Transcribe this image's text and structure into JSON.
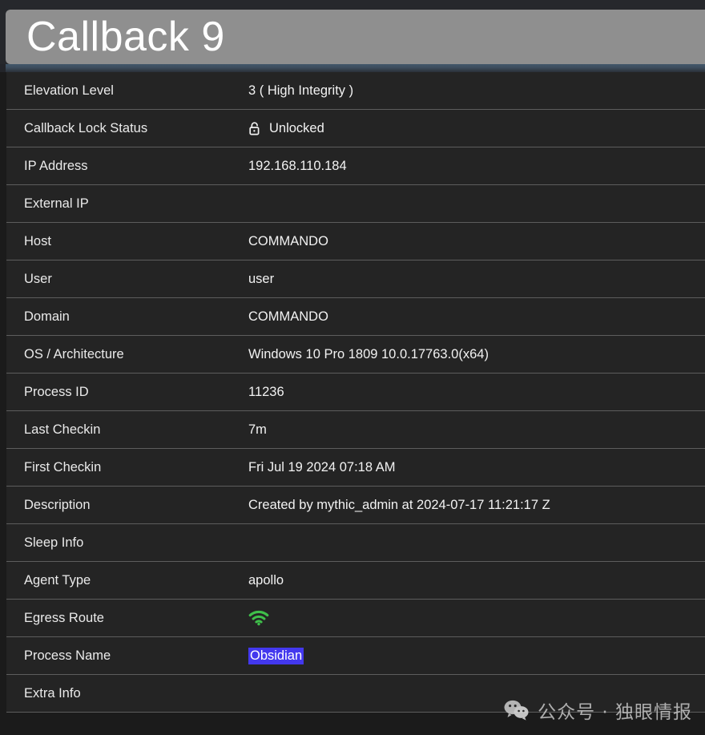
{
  "header": {
    "title": "Callback 9"
  },
  "rows": [
    {
      "label": "Elevation Level",
      "value": "3 ( High Integrity )",
      "icon": null
    },
    {
      "label": "Callback Lock Status",
      "value": "Unlocked",
      "icon": "unlock-icon"
    },
    {
      "label": "IP Address",
      "value": "192.168.110.184",
      "icon": null
    },
    {
      "label": "External IP",
      "value": "",
      "icon": null
    },
    {
      "label": "Host",
      "value": "COMMANDO",
      "icon": null
    },
    {
      "label": "User",
      "value": "user",
      "icon": null
    },
    {
      "label": "Domain",
      "value": "COMMANDO",
      "icon": null
    },
    {
      "label": "OS / Architecture",
      "value": "Windows 10 Pro 1809 10.0.17763.0(x64)",
      "icon": null
    },
    {
      "label": "Process ID",
      "value": "11236",
      "icon": null
    },
    {
      "label": "Last Checkin",
      "value": "7m",
      "icon": null
    },
    {
      "label": "First Checkin",
      "value": "Fri Jul 19 2024 07:18 AM",
      "icon": null
    },
    {
      "label": "Description",
      "value": "Created by mythic_admin at 2024-07-17 11:21:17 Z",
      "icon": null
    },
    {
      "label": "Sleep Info",
      "value": "",
      "icon": null
    },
    {
      "label": "Agent Type",
      "value": "apollo",
      "icon": null
    },
    {
      "label": "Egress Route",
      "value": "",
      "icon": "wifi-icon"
    },
    {
      "label": "Process Name",
      "value": "Obsidian",
      "icon": null,
      "selected": true
    },
    {
      "label": "Extra Info",
      "value": "",
      "icon": null
    }
  ],
  "watermark": {
    "icon": "wechat-logo-icon",
    "text": "公众号 · 独眼情报"
  },
  "colors": {
    "header_bar": "#8f8f8f",
    "row_background": "#242424",
    "divider": "#5d5d5d",
    "selection_highlight": "#4338ee",
    "wifi_green": "#3fbf4a",
    "page_background": "#1b1b1b"
  }
}
